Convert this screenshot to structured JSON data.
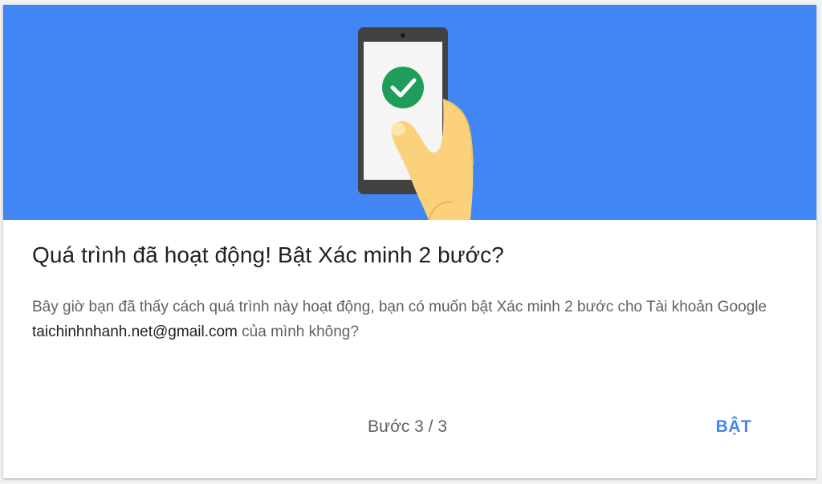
{
  "dialog": {
    "title": "Quá trình đã hoạt động! Bật Xác minh 2 bước?",
    "description_before": "Bây giờ bạn đã thấy cách quá trình này hoạt động, bạn có muốn bật Xác minh 2 bước cho Tài khoản Google ",
    "email": "taichinhnhanh.net@gmail.com",
    "description_after": " của mình không?",
    "step_indicator": "Bước 3 / 3",
    "turn_on_label": "BẬT"
  },
  "illustration": {
    "icons": [
      "phone-icon",
      "checkmark-icon",
      "hand-icon"
    ],
    "colors": {
      "hero_background": "#4285f4",
      "phone_body": "#424242",
      "screen": "#f5f5f5",
      "check_circle": "#1e9e5a",
      "hand": "#fbd17b"
    }
  },
  "colors": {
    "accent": "#4285f4",
    "title_text": "#212121",
    "body_text": "#616161"
  }
}
